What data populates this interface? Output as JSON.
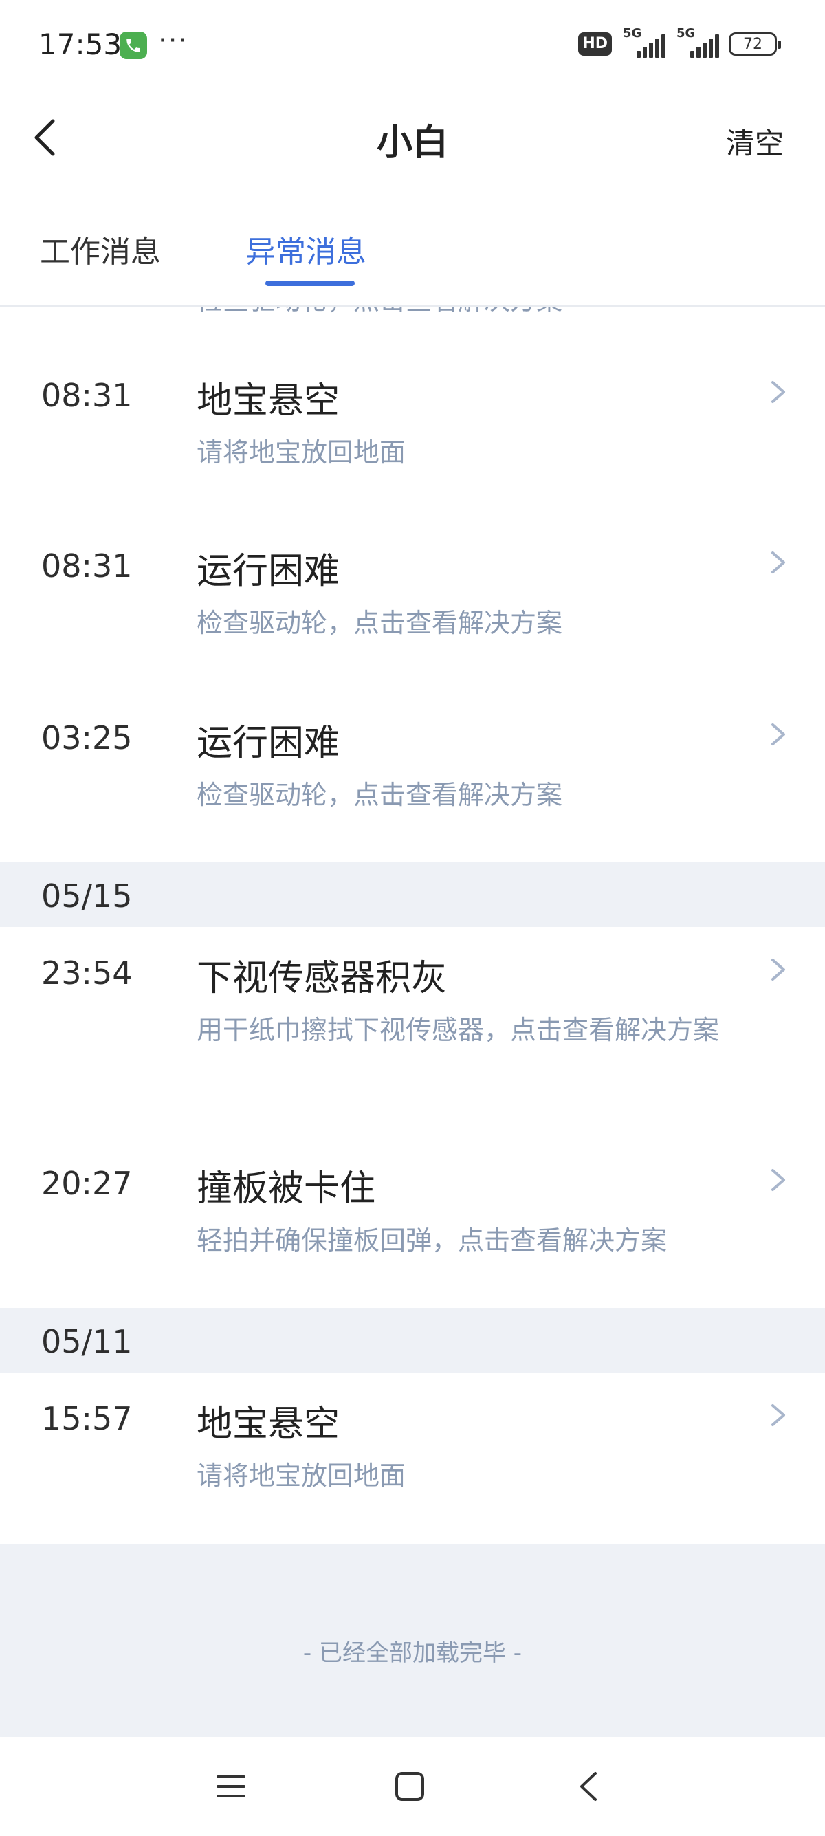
{
  "status_bar": {
    "time": "17:53",
    "more": "···",
    "hd": "HD",
    "network_1": "5G",
    "network_2": "5G",
    "battery": "72"
  },
  "header": {
    "title": "小白",
    "clear_label": "清空"
  },
  "tabs": [
    {
      "label": "工作消息",
      "active": false
    },
    {
      "label": "异常消息",
      "active": true
    }
  ],
  "clipped_item_desc": "检查驱动轮，点击查看解决方案",
  "groups": [
    {
      "date": "",
      "items": [
        {
          "time": "08:31",
          "title": "地宝悬空",
          "desc": "请将地宝放回地面"
        },
        {
          "time": "08:31",
          "title": "运行困难",
          "desc": "检查驱动轮，点击查看解决方案"
        },
        {
          "time": "03:25",
          "title": "运行困难",
          "desc": "检查驱动轮，点击查看解决方案"
        }
      ]
    },
    {
      "date": "05/15",
      "items": [
        {
          "time": "23:54",
          "title": "下视传感器积灰",
          "desc": "用干纸巾擦拭下视传感器，点击查看解决方案"
        },
        {
          "time": "20:27",
          "title": "撞板被卡住",
          "desc": "轻拍并确保撞板回弹，点击查看解决方案"
        }
      ]
    },
    {
      "date": "05/11",
      "items": [
        {
          "time": "15:57",
          "title": "地宝悬空",
          "desc": "请将地宝放回地面"
        }
      ]
    }
  ],
  "footer": "- 已经全部加载完毕 -",
  "colors": {
    "accent": "#3d6fdc",
    "secondary_text": "#8a9ab2",
    "section_bg": "#eef1f6"
  },
  "icons": {
    "back": "chevron-left-icon",
    "item_arrow": "chevron-right-icon",
    "nav_menu": "menu-icon",
    "nav_home": "home-square-icon",
    "nav_back": "back-triangle-icon"
  }
}
